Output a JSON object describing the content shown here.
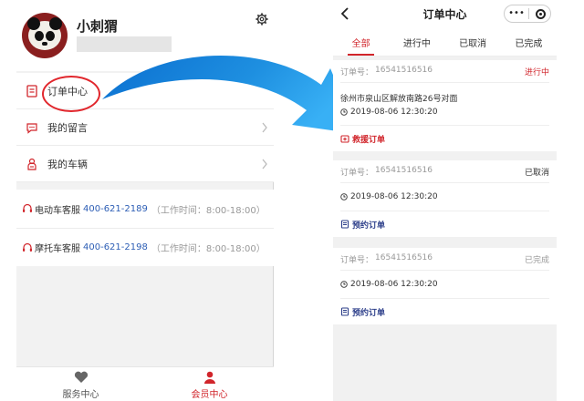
{
  "left": {
    "profile": {
      "name": "小刺猬"
    },
    "menu": [
      {
        "label": "订单中心"
      },
      {
        "label": "我的留言"
      },
      {
        "label": "我的车辆"
      }
    ],
    "services": [
      {
        "name": "电动车客服",
        "phone": "400-621-2189",
        "hours": "（工作时间：8:00-18:00）"
      },
      {
        "name": "摩托车客服",
        "phone": "400-621-2198",
        "hours": "（工作时间：8:00-18:00）"
      }
    ],
    "tabbar": [
      {
        "label": "服务中心",
        "icon": "heart-icon"
      },
      {
        "label": "会员中心",
        "icon": "user-icon"
      }
    ]
  },
  "right": {
    "header": {
      "title": "订单中心",
      "menu_dots": "•••"
    },
    "tabs": [
      {
        "label": "全部"
      },
      {
        "label": "进行中"
      },
      {
        "label": "已取消"
      },
      {
        "label": "已完成"
      }
    ],
    "order_label": "订单号：",
    "orders": [
      {
        "number": "16541516516",
        "status": "进行中",
        "address": "徐州市泉山区解放南路26号对面",
        "time": "2019-08-06 12:30:20",
        "action": "救援订单"
      },
      {
        "number": "16541516516",
        "status": "已取消",
        "time": "2019-08-06 12:30:20",
        "action": "预约订单"
      },
      {
        "number": "16541516516",
        "status": "已完成",
        "time": "2019-08-06 12:30:20",
        "action": "预约订单"
      }
    ]
  },
  "colors": {
    "accent_red": "#d1252b",
    "link_blue": "#2d5eb5",
    "arrow_blue": "#1e8fe0"
  }
}
